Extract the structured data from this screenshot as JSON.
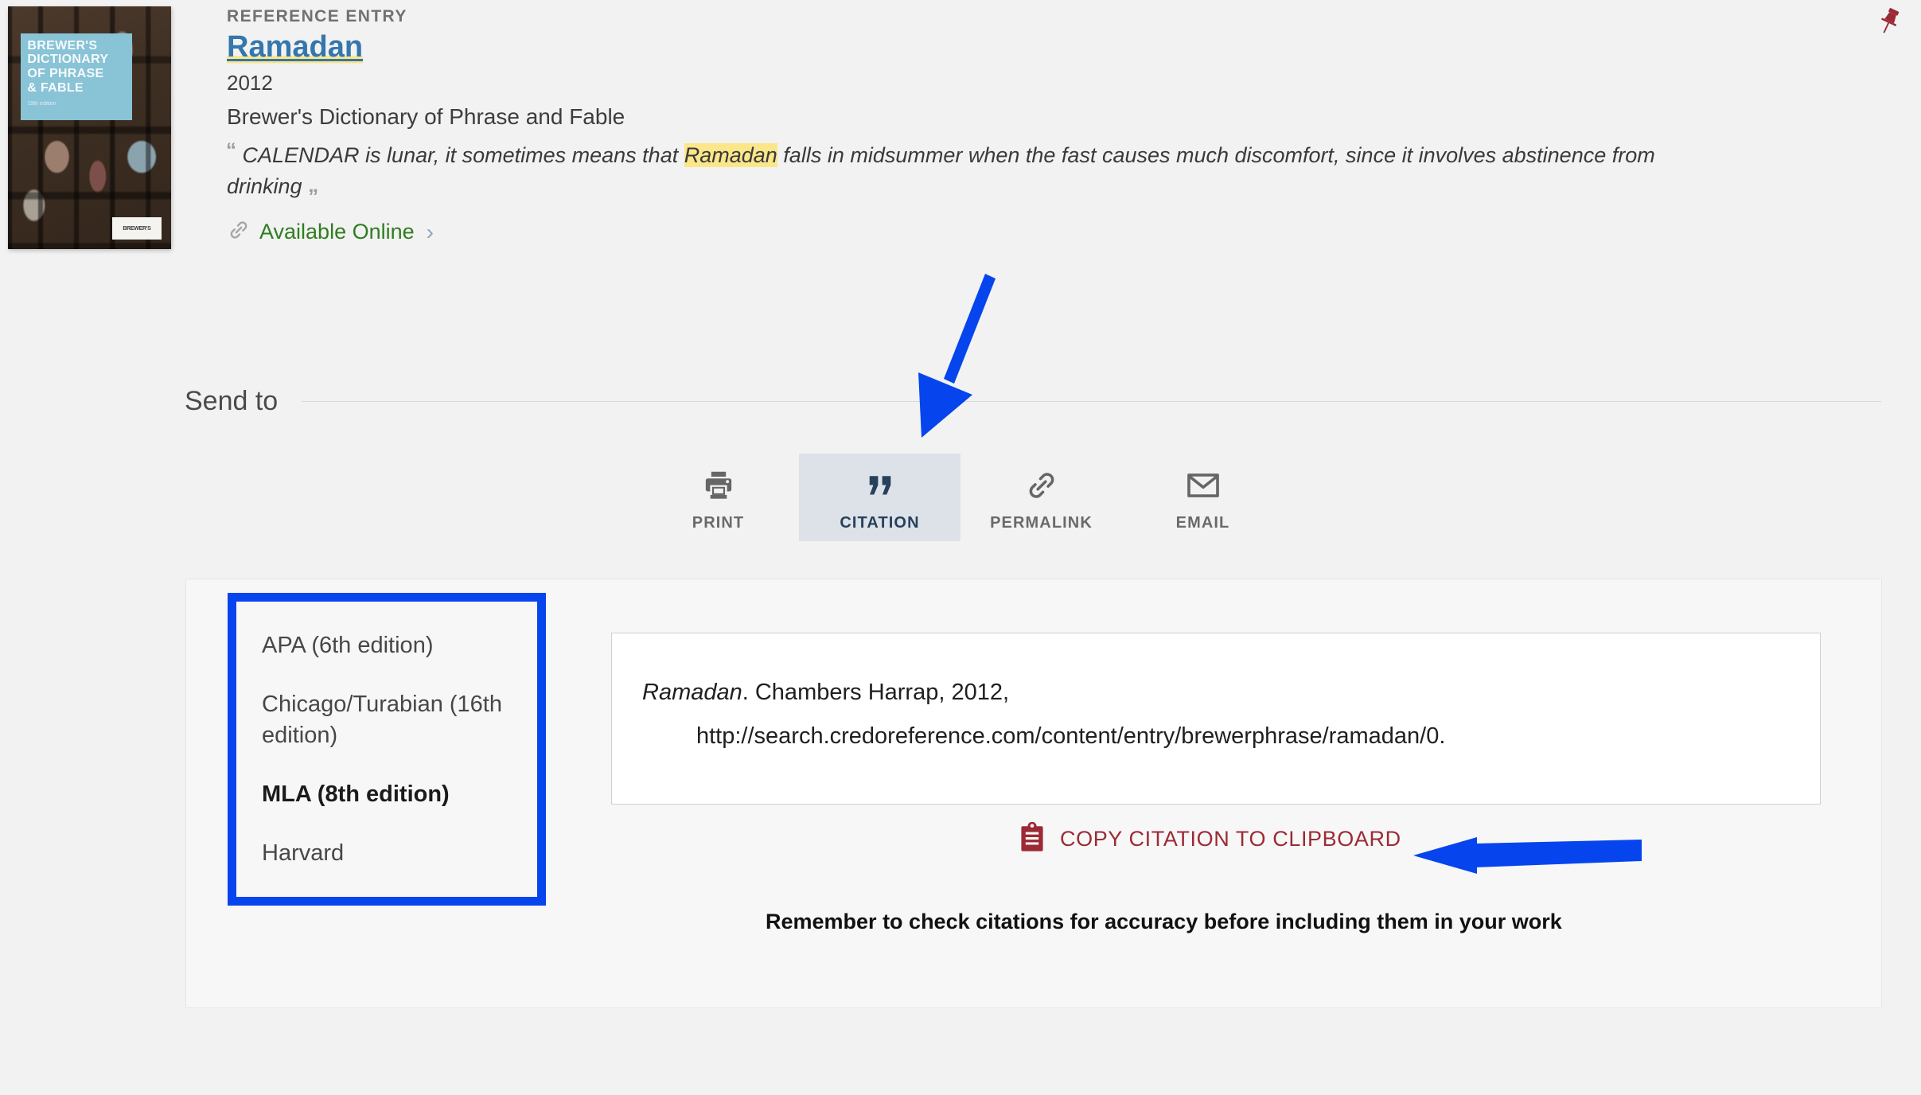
{
  "result": {
    "kicker": "REFERENCE ENTRY",
    "title": "Ramadan",
    "year": "2012",
    "source": "Brewer's Dictionary of Phrase and Fable",
    "snippet_before": "CALENDAR is lunar, it sometimes means that ",
    "snippet_highlight": "Ramadan",
    "snippet_after": " falls in midsummer when the fast causes much discomfort, since it involves abstinence from drinking",
    "available_label": "Available Online",
    "available_chevron": "›",
    "cover": {
      "title_lines": [
        "BREWER'S",
        "DICTIONARY",
        "OF PHRASE",
        "& FABLE"
      ],
      "subtitle": "19th edition",
      "logo_text": "BREWER'S"
    },
    "pin_icon": "pushpin-icon"
  },
  "send_to": {
    "label": "Send to",
    "tools": [
      {
        "label": "PRINT",
        "icon": "printer-icon",
        "active": false
      },
      {
        "label": "CITATION",
        "icon": "quote-icon",
        "active": true
      },
      {
        "label": "PERMALINK",
        "icon": "link-icon",
        "active": false
      },
      {
        "label": "EMAIL",
        "icon": "envelope-icon",
        "active": false
      }
    ]
  },
  "citation": {
    "styles": [
      {
        "label": "APA (6th edition)",
        "selected": false
      },
      {
        "label": "Chicago/Turabian (16th edition)",
        "selected": false
      },
      {
        "label": "MLA (8th edition)",
        "selected": true
      },
      {
        "label": "Harvard",
        "selected": false
      }
    ],
    "text_italic": "Ramadan",
    "text_rest": ". Chambers Harrap, 2012,",
    "text_url": "http://search.credoreference.com/content/entry/brewerphrase/ramadan/0.",
    "copy_label": "COPY CITATION TO CLIPBOARD",
    "copy_icon": "clipboard-icon",
    "reminder": "Remember to check citations for accuracy before including them in your work"
  },
  "annotations": {
    "arrow_to_citation_tab": "blue-arrow-down-left",
    "arrow_to_copy_button": "blue-arrow-left"
  },
  "colors": {
    "page_background": "#f2f2f2",
    "panel_background": "#f7f7f7",
    "title_link": "#3576ad",
    "highlight": "#fbe78a",
    "available_online": "#2f7d20",
    "active_tab_background": "#dde2e8",
    "active_tab_text": "#27405c",
    "copy_link": "#9c2a35",
    "pin": "#9c2a35",
    "annotation_blue": "#0645ed"
  }
}
